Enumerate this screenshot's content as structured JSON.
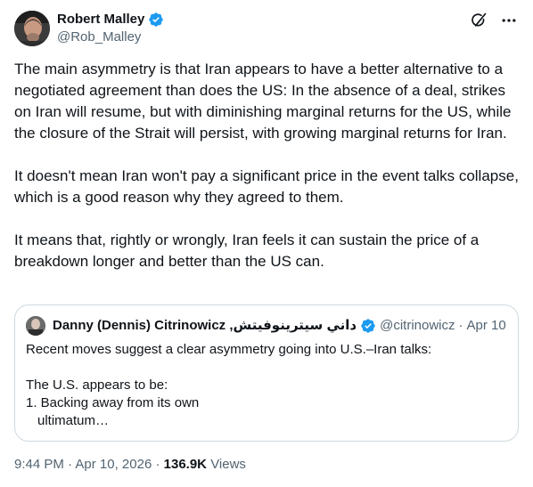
{
  "author": {
    "display_name": "Robert Malley",
    "handle": "@Rob_Malley",
    "verified": true
  },
  "actions": {
    "grok_icon": "grok-icon",
    "more_icon": "more-icon"
  },
  "post": {
    "paragraphs": [
      "The main asymmetry is that Iran appears to have a better alternative to a negotiated agreement than does the US:  In the absence of a deal, strikes on Iran will resume, but with diminishing marginal returns for the US, while the closure of the Strait will persist, with growing marginal returns for Iran.",
      "It doesn't mean Iran won't pay a significant price in the event talks collapse, which is a good reason why they agreed to them.",
      "It means that, rightly or wrongly, Iran feels it can sustain the price of a breakdown longer and better than the US can."
    ]
  },
  "quote": {
    "display_name": "Danny (Dennis) Citrinowicz ,داني سيترينوفيتش",
    "verified": true,
    "handle": "@citrinowicz",
    "separator": "·",
    "date": "Apr 10",
    "lines": [
      "Recent moves suggest a clear asymmetry going into U.S.–Iran talks:",
      "",
      "The U.S. appears to be:",
      "1. Backing away from its own",
      "ultimatum…"
    ]
  },
  "meta": {
    "time": "9:44 PM",
    "separator": "·",
    "date": "Apr 10, 2026",
    "views_count": "136.9K",
    "views_label": "Views"
  },
  "colors": {
    "verified_blue": "#1d9bf0",
    "text_primary": "#0f1419",
    "text_secondary": "#536471",
    "border": "#cfd9de"
  }
}
